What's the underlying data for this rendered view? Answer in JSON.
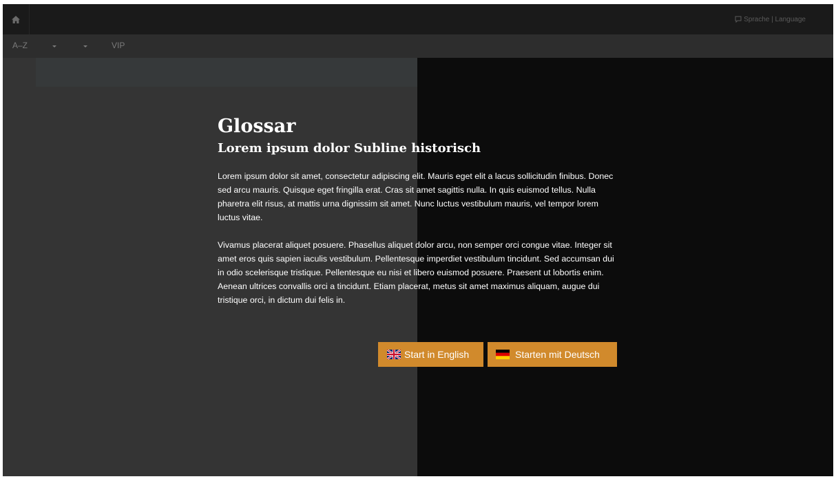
{
  "topbar": {
    "home_icon": "home-icon",
    "language_icon": "speech-bubble-icon",
    "language_link": "Sprache | Language"
  },
  "subbar": {
    "items": [
      "A–Z",
      "VIP"
    ],
    "dropdown_icon": "caret-down-icon"
  },
  "main": {
    "title": "Glossar",
    "subtitle": "Lorem ipsum dolor Subline historisch",
    "paragraphs": [
      "Lorem ipsum dolor sit amet, consectetur adipiscing elit. Mauris eget elit a lacus sollicitudin finibus. Donec sed arcu mauris. Quisque eget fringilla erat. Cras sit amet sagittis nulla. In quis euismod tellus. Nulla pharetra elit risus, at mattis urna dignissim sit amet. Nunc luctus vestibulum mauris, vel tempor lorem luctus vitae.",
      "Vivamus placerat aliquet posuere. Phasellus aliquet dolor arcu, non semper orci congue vitae. Integer sit amet eros quis sapien iaculis vestibulum. Pellentesque imperdiet vestibulum tincidunt. Sed accumsan dui in odio scelerisque tristique. Pellentesque eu nisi et libero euismod posuere. Praesent ut lobortis enim. Aenean ultrices convallis orci a tincidunt. Etiam placerat, metus sit amet maximus aliquam, augue dui tristique orci, in dictum dui felis in."
    ]
  },
  "buttons": {
    "english": "Start in English",
    "english_icon": "uk-flag-icon",
    "german": "Starten mit Deutsch",
    "german_icon": "german-flag-icon"
  },
  "colors": {
    "accent": "#d18a2c",
    "left_panel": "#343434",
    "right_panel": "#0c0c0c",
    "topbar": "#1a1a1a",
    "subbar": "#2d2d2d"
  }
}
